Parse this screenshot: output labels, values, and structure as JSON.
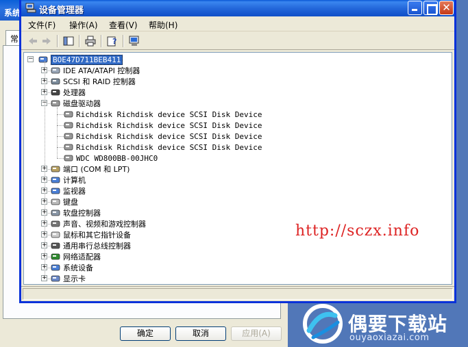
{
  "background_window": {
    "title": "系统",
    "tab_label": "常",
    "buttons": {
      "ok": "确定",
      "cancel": "取消",
      "apply": "应用(A)"
    }
  },
  "watermark": {
    "brand": "偶要下载站",
    "domain": "ouyaoxiazai.com",
    "url_overlay": "http://sczx.info"
  },
  "window": {
    "title": "设备管理器",
    "controls": {
      "close": "✕"
    }
  },
  "menu": [
    {
      "label": "文件(F)"
    },
    {
      "label": "操作(A)"
    },
    {
      "label": "查看(V)"
    },
    {
      "label": "帮助(H)"
    }
  ],
  "toolbar": {
    "icons": [
      "back-arrow-icon",
      "forward-arrow-icon",
      "show-hide-tree-icon",
      "print-icon",
      "properties-help-icon",
      "device-info-icon"
    ]
  },
  "tree": {
    "root": "BOE47D711BEB411",
    "expand_symbol": "+",
    "collapse_symbol": "−",
    "categories": [
      {
        "label": "IDE ATA/ATAPI 控制器",
        "icon": "ide-controller-icon",
        "expanded": false
      },
      {
        "label": "SCSI 和 RAID 控制器",
        "icon": "scsi-controller-icon",
        "expanded": false
      },
      {
        "label": "处理器",
        "icon": "processor-icon",
        "expanded": false
      },
      {
        "label": "磁盘驱动器",
        "icon": "disk-drive-icon",
        "expanded": true,
        "children": [
          "Richdisk Richdisk device SCSI Disk Device",
          "Richdisk Richdisk device SCSI Disk Device",
          "Richdisk Richdisk device SCSI Disk Device",
          "Richdisk Richdisk device SCSI Disk Device",
          "WDC WD800BB-00JHC0"
        ]
      },
      {
        "label": "端口 (COM 和 LPT)",
        "icon": "port-icon",
        "expanded": false
      },
      {
        "label": "计算机",
        "icon": "computer-icon",
        "expanded": false
      },
      {
        "label": "监视器",
        "icon": "monitor-icon",
        "expanded": false
      },
      {
        "label": "键盘",
        "icon": "keyboard-icon",
        "expanded": false
      },
      {
        "label": "软盘控制器",
        "icon": "floppy-controller-icon",
        "expanded": false
      },
      {
        "label": "声音、视频和游戏控制器",
        "icon": "sound-icon",
        "expanded": false
      },
      {
        "label": "鼠标和其它指针设备",
        "icon": "mouse-icon",
        "expanded": false
      },
      {
        "label": "通用串行总线控制器",
        "icon": "usb-icon",
        "expanded": false
      },
      {
        "label": "网络适配器",
        "icon": "network-adapter-icon",
        "expanded": false
      },
      {
        "label": "系统设备",
        "icon": "system-device-icon",
        "expanded": false
      },
      {
        "label": "显示卡",
        "icon": "display-adapter-icon",
        "expanded": false
      }
    ]
  },
  "colors": {
    "titlebar": "#0a58d6",
    "selection": "#316ac5",
    "url_overlay": "#dd2222",
    "watermark_bg": "#5177b8"
  }
}
